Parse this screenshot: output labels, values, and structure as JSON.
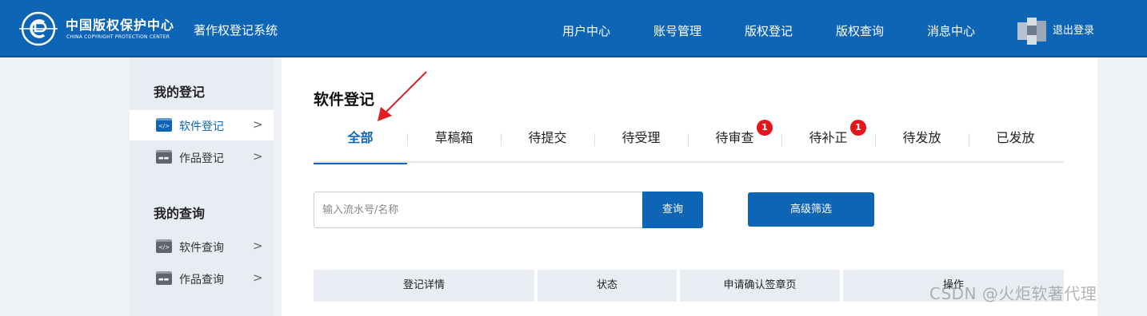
{
  "header": {
    "logo_cn": "中国版权保护中心",
    "logo_en": "CHINA COPYRIGHT PROTECTION CENTER",
    "app_title": "著作权登记系统",
    "nav": [
      "用户中心",
      "账号管理",
      "版权登记",
      "版权查询",
      "消息中心"
    ],
    "logout": "退出登录",
    "colors": {
      "primary": "#0f65b5"
    }
  },
  "sidebar": {
    "sections": [
      {
        "heading": "我的登记",
        "items": [
          {
            "label": "软件登记",
            "icon": "software-doc-icon",
            "active": true
          },
          {
            "label": "作品登记",
            "icon": "work-doc-icon",
            "active": false
          }
        ]
      },
      {
        "heading": "我的查询",
        "items": [
          {
            "label": "软件查询",
            "icon": "software-doc-icon",
            "active": false
          },
          {
            "label": "作品查询",
            "icon": "work-doc-icon",
            "active": false
          }
        ]
      }
    ]
  },
  "main": {
    "title": "软件登记",
    "tabs": [
      {
        "label": "全部",
        "active": true
      },
      {
        "label": "草稿箱"
      },
      {
        "label": "待提交"
      },
      {
        "label": "待受理"
      },
      {
        "label": "待审查",
        "badge": "1"
      },
      {
        "label": "待补正",
        "badge": "1"
      },
      {
        "label": "待发放"
      },
      {
        "label": "已发放"
      }
    ],
    "search": {
      "placeholder": "输入流水号/名称",
      "query_button": "查询"
    },
    "filter_button": "高级筛选",
    "table_headers": [
      "登记详情",
      "状态",
      "申请确认签章页",
      "操作"
    ]
  },
  "watermark": "CSDN @火炬软著代理"
}
